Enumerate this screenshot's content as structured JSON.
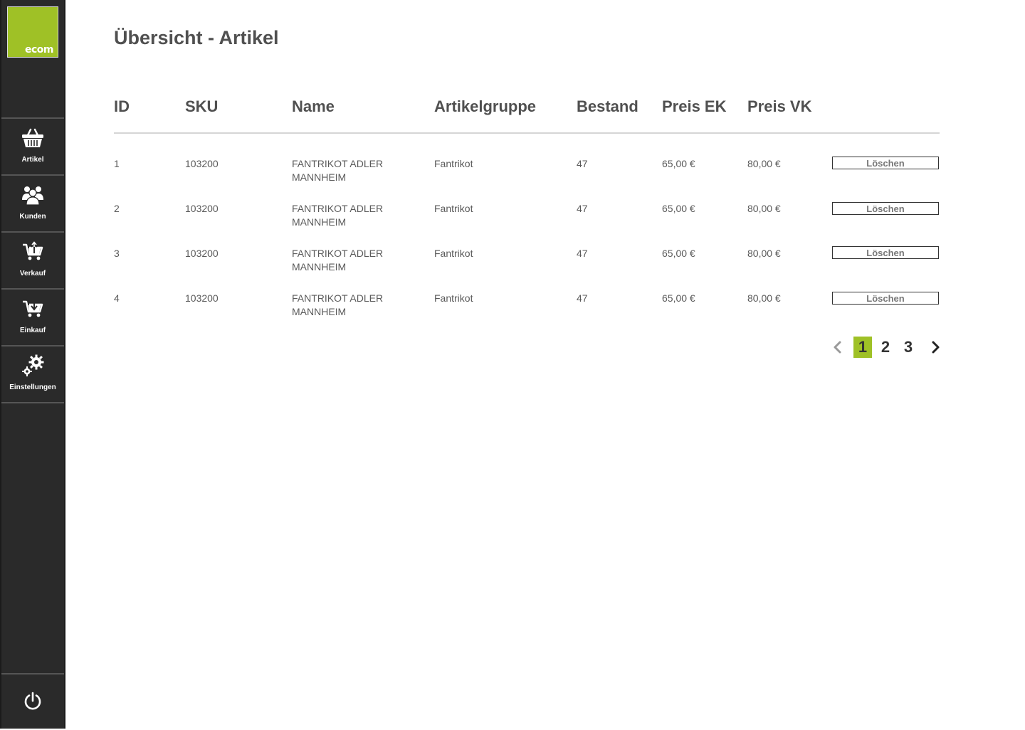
{
  "app": {
    "title": "Übersicht - Artikel",
    "logo_text": "ecom",
    "brand_color": "#9fc126"
  },
  "sidebar": {
    "items": [
      {
        "label": "Artikel",
        "icon": "basket-icon"
      },
      {
        "label": "Kunden",
        "icon": "users-icon"
      },
      {
        "label": "Verkauf",
        "icon": "cart-upload-icon"
      },
      {
        "label": "Einkauf",
        "icon": "cart-download-icon"
      },
      {
        "label": "Einstellungen",
        "icon": "gears-icon"
      }
    ],
    "power_icon": "power-icon"
  },
  "table": {
    "headers": [
      "ID",
      "SKU",
      "Name",
      "Artikelgruppe",
      "Bestand",
      "Preis EK",
      "Preis VK"
    ],
    "rows": [
      {
        "id": "1",
        "sku": "103200",
        "name_line1": "FANTRIKOT ADLER",
        "name_line2": "MANNHEIM",
        "group": "Fantrikot",
        "stock": "47",
        "ek": "65,00 €",
        "vk": "80,00 €",
        "action": "Löschen"
      },
      {
        "id": "2",
        "sku": "103200",
        "name_line1": "FANTRIKOT ADLER",
        "name_line2": "MANNHEIM",
        "group": "Fantrikot",
        "stock": "47",
        "ek": "65,00 €",
        "vk": "80,00 €",
        "action": "Löschen"
      },
      {
        "id": "3",
        "sku": "103200",
        "name_line1": "FANTRIKOT ADLER",
        "name_line2": "MANNHEIM",
        "group": "Fantrikot",
        "stock": "47",
        "ek": "65,00 €",
        "vk": "80,00 €",
        "action": "Löschen"
      },
      {
        "id": "4",
        "sku": "103200",
        "name_line1": "FANTRIKOT ADLER",
        "name_line2": "MANNHEIM",
        "group": "Fantrikot",
        "stock": "47",
        "ek": "65,00 €",
        "vk": "80,00 €",
        "action": "Löschen"
      }
    ]
  },
  "pagination": {
    "pages": [
      "1",
      "2",
      "3"
    ],
    "current": "1",
    "prev_icon": "chevron-left-icon",
    "next_icon": "chevron-right-icon"
  }
}
